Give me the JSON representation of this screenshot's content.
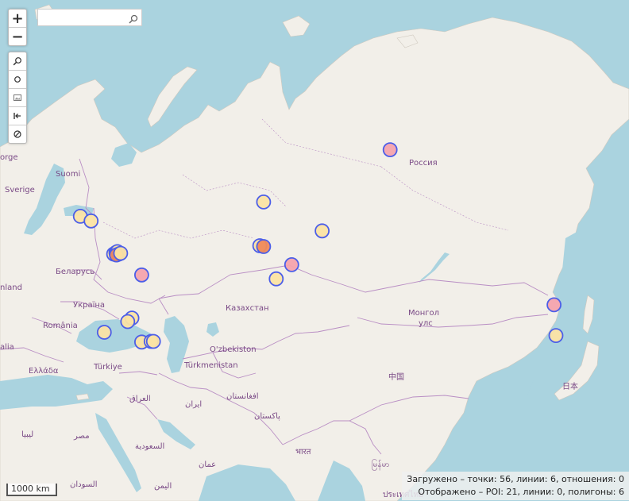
{
  "controls": {
    "zoom_in": "+",
    "zoom_out": "−",
    "icons": [
      "magnifier-icon",
      "circle-icon",
      "image-icon",
      "arrow-left-bar-icon",
      "no-entry-icon"
    ]
  },
  "search": {
    "placeholder": ""
  },
  "labels": {
    "russia": "Россия",
    "suomi": "Suomi",
    "sverige": "Sverige",
    "norge": "orge",
    "belarus": "Беларусь",
    "ukraina": "Україна",
    "romania": "România",
    "ellada": "Ελλάδα",
    "turkiye": "Türkiye",
    "kazakhstan": "Казахстан",
    "uzbekiston": "O'zbekiston",
    "turkmenistan": "Türkmenistan",
    "mongol_1": "Монгол",
    "mongol_2": "улс",
    "china": "中国",
    "japan": "日本",
    "afghanistan": "افغانستان",
    "iraq": "العراق",
    "iran": "ایران",
    "pakistan": "پاکستان",
    "india": "भारत",
    "myanmar": "မြန်မာ",
    "thailand": "ประเทศไทย",
    "libya": "ليبيا",
    "egypt": "مصر",
    "saudi": "السعودية",
    "oman": "عمان",
    "yemen": "اليمن",
    "sudan": "السودان",
    "italia": "alia",
    "finland_hint": "nland"
  },
  "scale": {
    "label": "1000 km"
  },
  "stats": {
    "loaded": "Загружено – точки: 56, линии: 6, отношения: 0",
    "shown": "Отображено – POI: 21, линии: 0, полигоны: 6"
  },
  "colors": {
    "water": "#aad3df",
    "land": "#f2efe9",
    "border": "#b98ec4",
    "marker_stroke": "#4c5ee8",
    "marker_yellow": "#fbe3a4",
    "marker_pink": "#f4a3ae",
    "marker_orange": "#f08a5a"
  },
  "markers": [
    {
      "lon": 69.5,
      "lat": 61.4,
      "kind": "yellow"
    },
    {
      "lon": 96.5,
      "lat": 66.3,
      "kind": "pink"
    },
    {
      "lon": 82.0,
      "lat": 58.3,
      "kind": "yellow"
    },
    {
      "lon": 30.4,
      "lat": 59.9,
      "kind": "yellow"
    },
    {
      "lon": 32.7,
      "lat": 59.4,
      "kind": "yellow"
    },
    {
      "lon": 37.5,
      "lat": 55.6,
      "kind": "yellow"
    },
    {
      "lon": 38.0,
      "lat": 55.8,
      "kind": "yellow"
    },
    {
      "lon": 38.3,
      "lat": 55.9,
      "kind": "yellow"
    },
    {
      "lon": 38.6,
      "lat": 55.6,
      "kind": "orange"
    },
    {
      "lon": 38.1,
      "lat": 55.5,
      "kind": "orange"
    },
    {
      "lon": 39.0,
      "lat": 55.7,
      "kind": "yellow"
    },
    {
      "lon": 68.7,
      "lat": 56.6,
      "kind": "yellow"
    },
    {
      "lon": 69.5,
      "lat": 56.5,
      "kind": "orange"
    },
    {
      "lon": 75.5,
      "lat": 54.3,
      "kind": "pink"
    },
    {
      "lon": 43.5,
      "lat": 53.0,
      "kind": "pink"
    },
    {
      "lon": 72.2,
      "lat": 52.5,
      "kind": "yellow"
    },
    {
      "lon": 41.4,
      "lat": 47.1,
      "kind": "yellow"
    },
    {
      "lon": 40.5,
      "lat": 46.6,
      "kind": "yellow"
    },
    {
      "lon": 35.5,
      "lat": 45.0,
      "kind": "yellow"
    },
    {
      "lon": 43.5,
      "lat": 43.5,
      "kind": "yellow"
    },
    {
      "lon": 45.5,
      "lat": 43.6,
      "kind": "yellow"
    },
    {
      "lon": 46.0,
      "lat": 43.6,
      "kind": "yellow"
    },
    {
      "lon": 131.5,
      "lat": 49.0,
      "kind": "pink"
    },
    {
      "lon": 131.9,
      "lat": 44.5,
      "kind": "yellow"
    }
  ]
}
